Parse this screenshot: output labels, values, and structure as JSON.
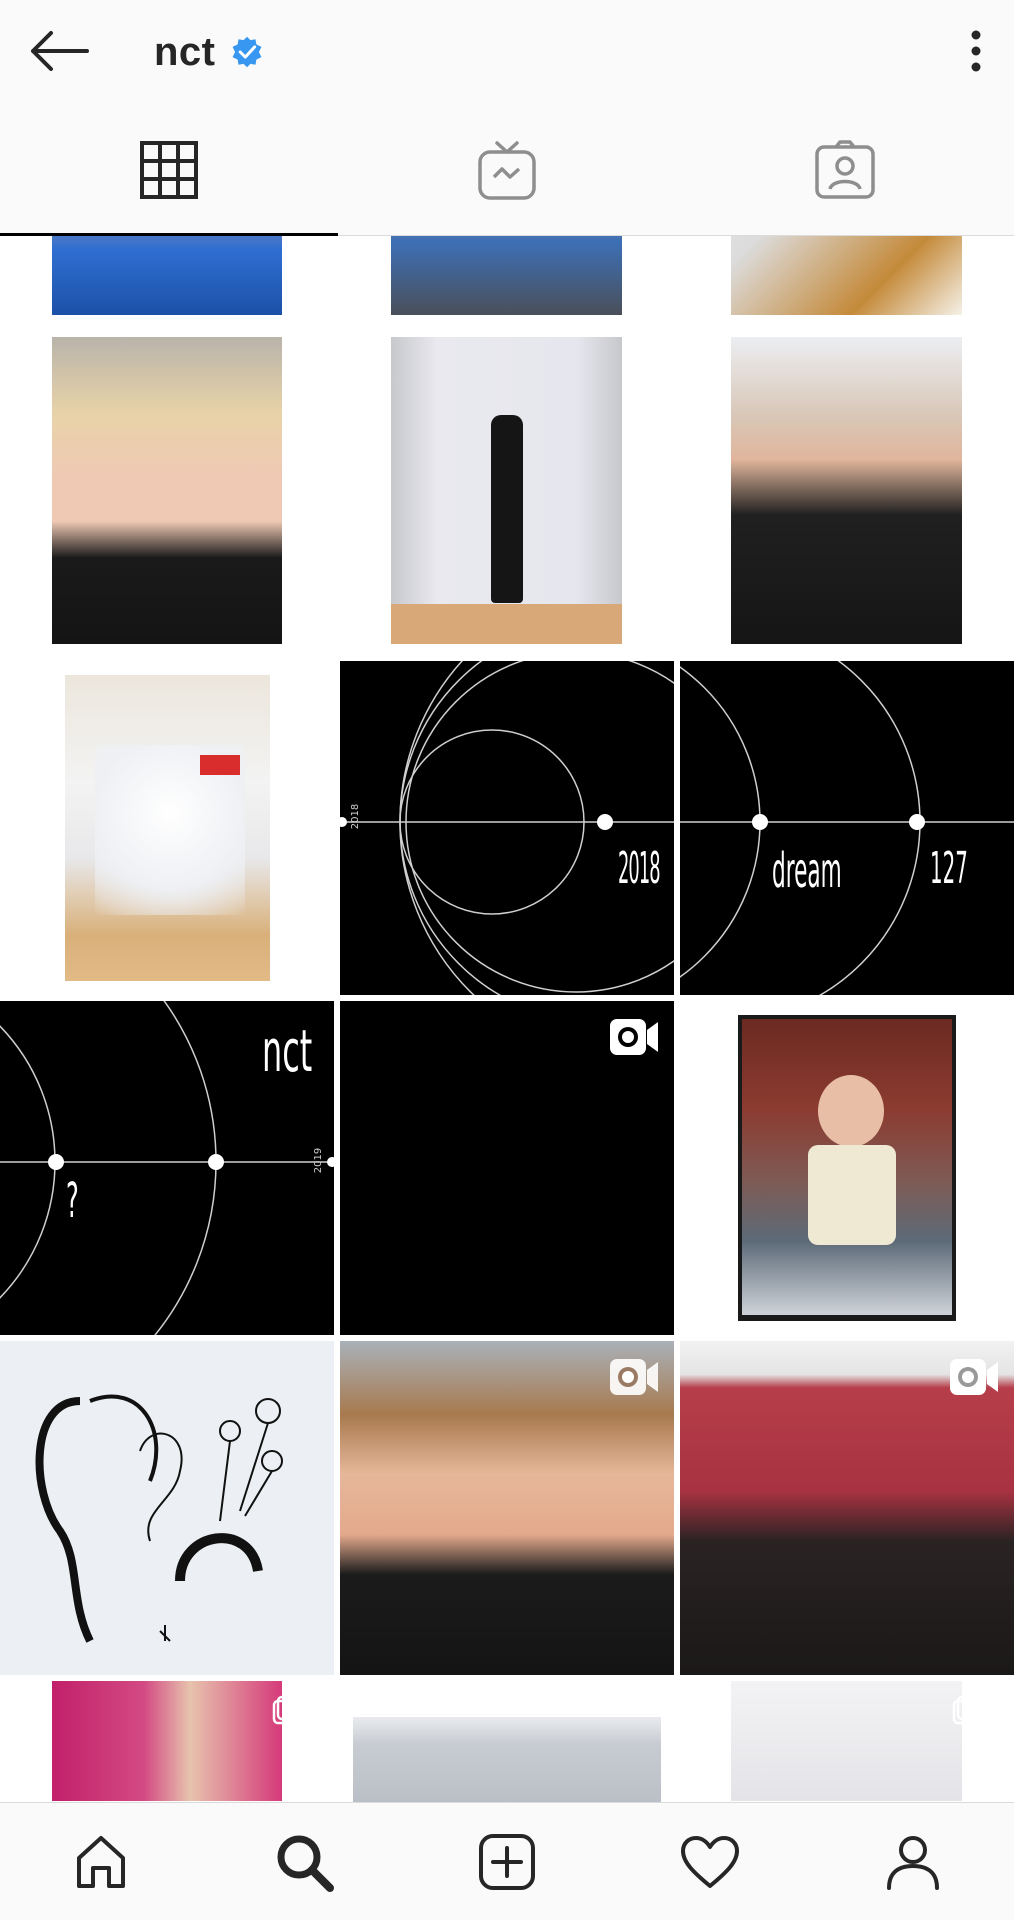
{
  "header": {
    "title": "nct",
    "verified": true,
    "back_icon": "arrow-left-icon",
    "more_icon": "more-vertical-icon"
  },
  "tabs": [
    {
      "name": "grid",
      "icon": "grid-icon",
      "active": true
    },
    {
      "name": "igtv",
      "icon": "igtv-icon",
      "active": false
    },
    {
      "name": "tagged",
      "icon": "tagged-user-icon",
      "active": false
    }
  ],
  "posts": {
    "tile_2018_label": "2018",
    "tile_2018_year": "2018",
    "tile_dream_label": "dream",
    "tile_127_label": "127",
    "tile_nct_logo": "nct",
    "tile_question_label": "?",
    "tile_2019_year": "2019"
  },
  "bottom_nav": [
    {
      "name": "home",
      "icon": "home-icon"
    },
    {
      "name": "search",
      "icon": "search-icon",
      "active": true
    },
    {
      "name": "new-post",
      "icon": "add-post-icon"
    },
    {
      "name": "activity",
      "icon": "heart-icon"
    },
    {
      "name": "profile",
      "icon": "profile-icon"
    }
  ],
  "colors": {
    "verified_blue": "#3897f0",
    "text": "#262626",
    "bar_background": "#fafafa",
    "divider": "#dbdbdb"
  }
}
